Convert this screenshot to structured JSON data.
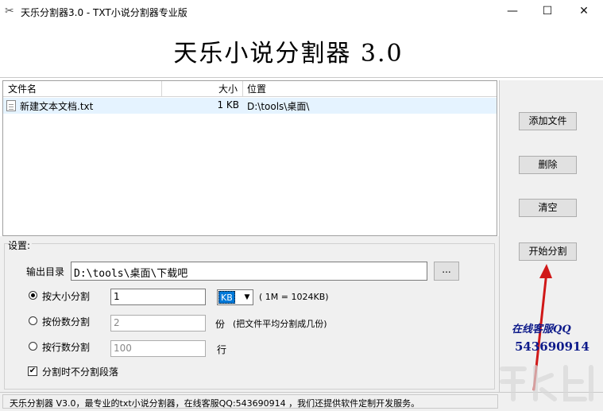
{
  "window": {
    "title": "天乐分割器3.0 - TXT小说分割器专业版",
    "minimize": "—",
    "maximize": "☐",
    "close": "✕"
  },
  "banner": {
    "title": "天乐小说分割器 3.0"
  },
  "file_list": {
    "columns": [
      "文件名",
      "大小",
      "位置"
    ],
    "rows": [
      {
        "name": "新建文本文档.txt",
        "size": "1 KB",
        "path": "D:\\tools\\桌面\\"
      }
    ]
  },
  "buttons": {
    "add_file": "添加文件",
    "delete": "删除",
    "clear": "清空",
    "start_split": "开始分割",
    "browse": "..."
  },
  "settings": {
    "legend": "设置:",
    "output_label": "输出目录",
    "output_value": "D:\\tools\\桌面\\下载吧",
    "by_size_label": "按大小分割",
    "by_size_value": "1",
    "unit_value": "KB",
    "unit_note": "( 1M = 1024KB)",
    "by_parts_label": "按份数分割",
    "by_parts_value": "2",
    "parts_unit": "份",
    "parts_note": "(把文件平均分割成几份)",
    "by_lines_label": "按行数分割",
    "by_lines_value": "100",
    "lines_unit": "行",
    "keep_paragraph_label": "分割时不分割段落",
    "keep_paragraph_checked": true,
    "selected_mode": "by_size"
  },
  "support": {
    "label": "在线客服QQ",
    "number": "543690914"
  },
  "status": {
    "text": "天乐分割器 V3.0，最专业的txt小说分割器，在线客服QQ:543690914 ，我们还提供软件定制开发服务。"
  },
  "colors": {
    "selection": "#0078d7",
    "support_text": "#0d1a8a",
    "arrow": "#d01818"
  }
}
